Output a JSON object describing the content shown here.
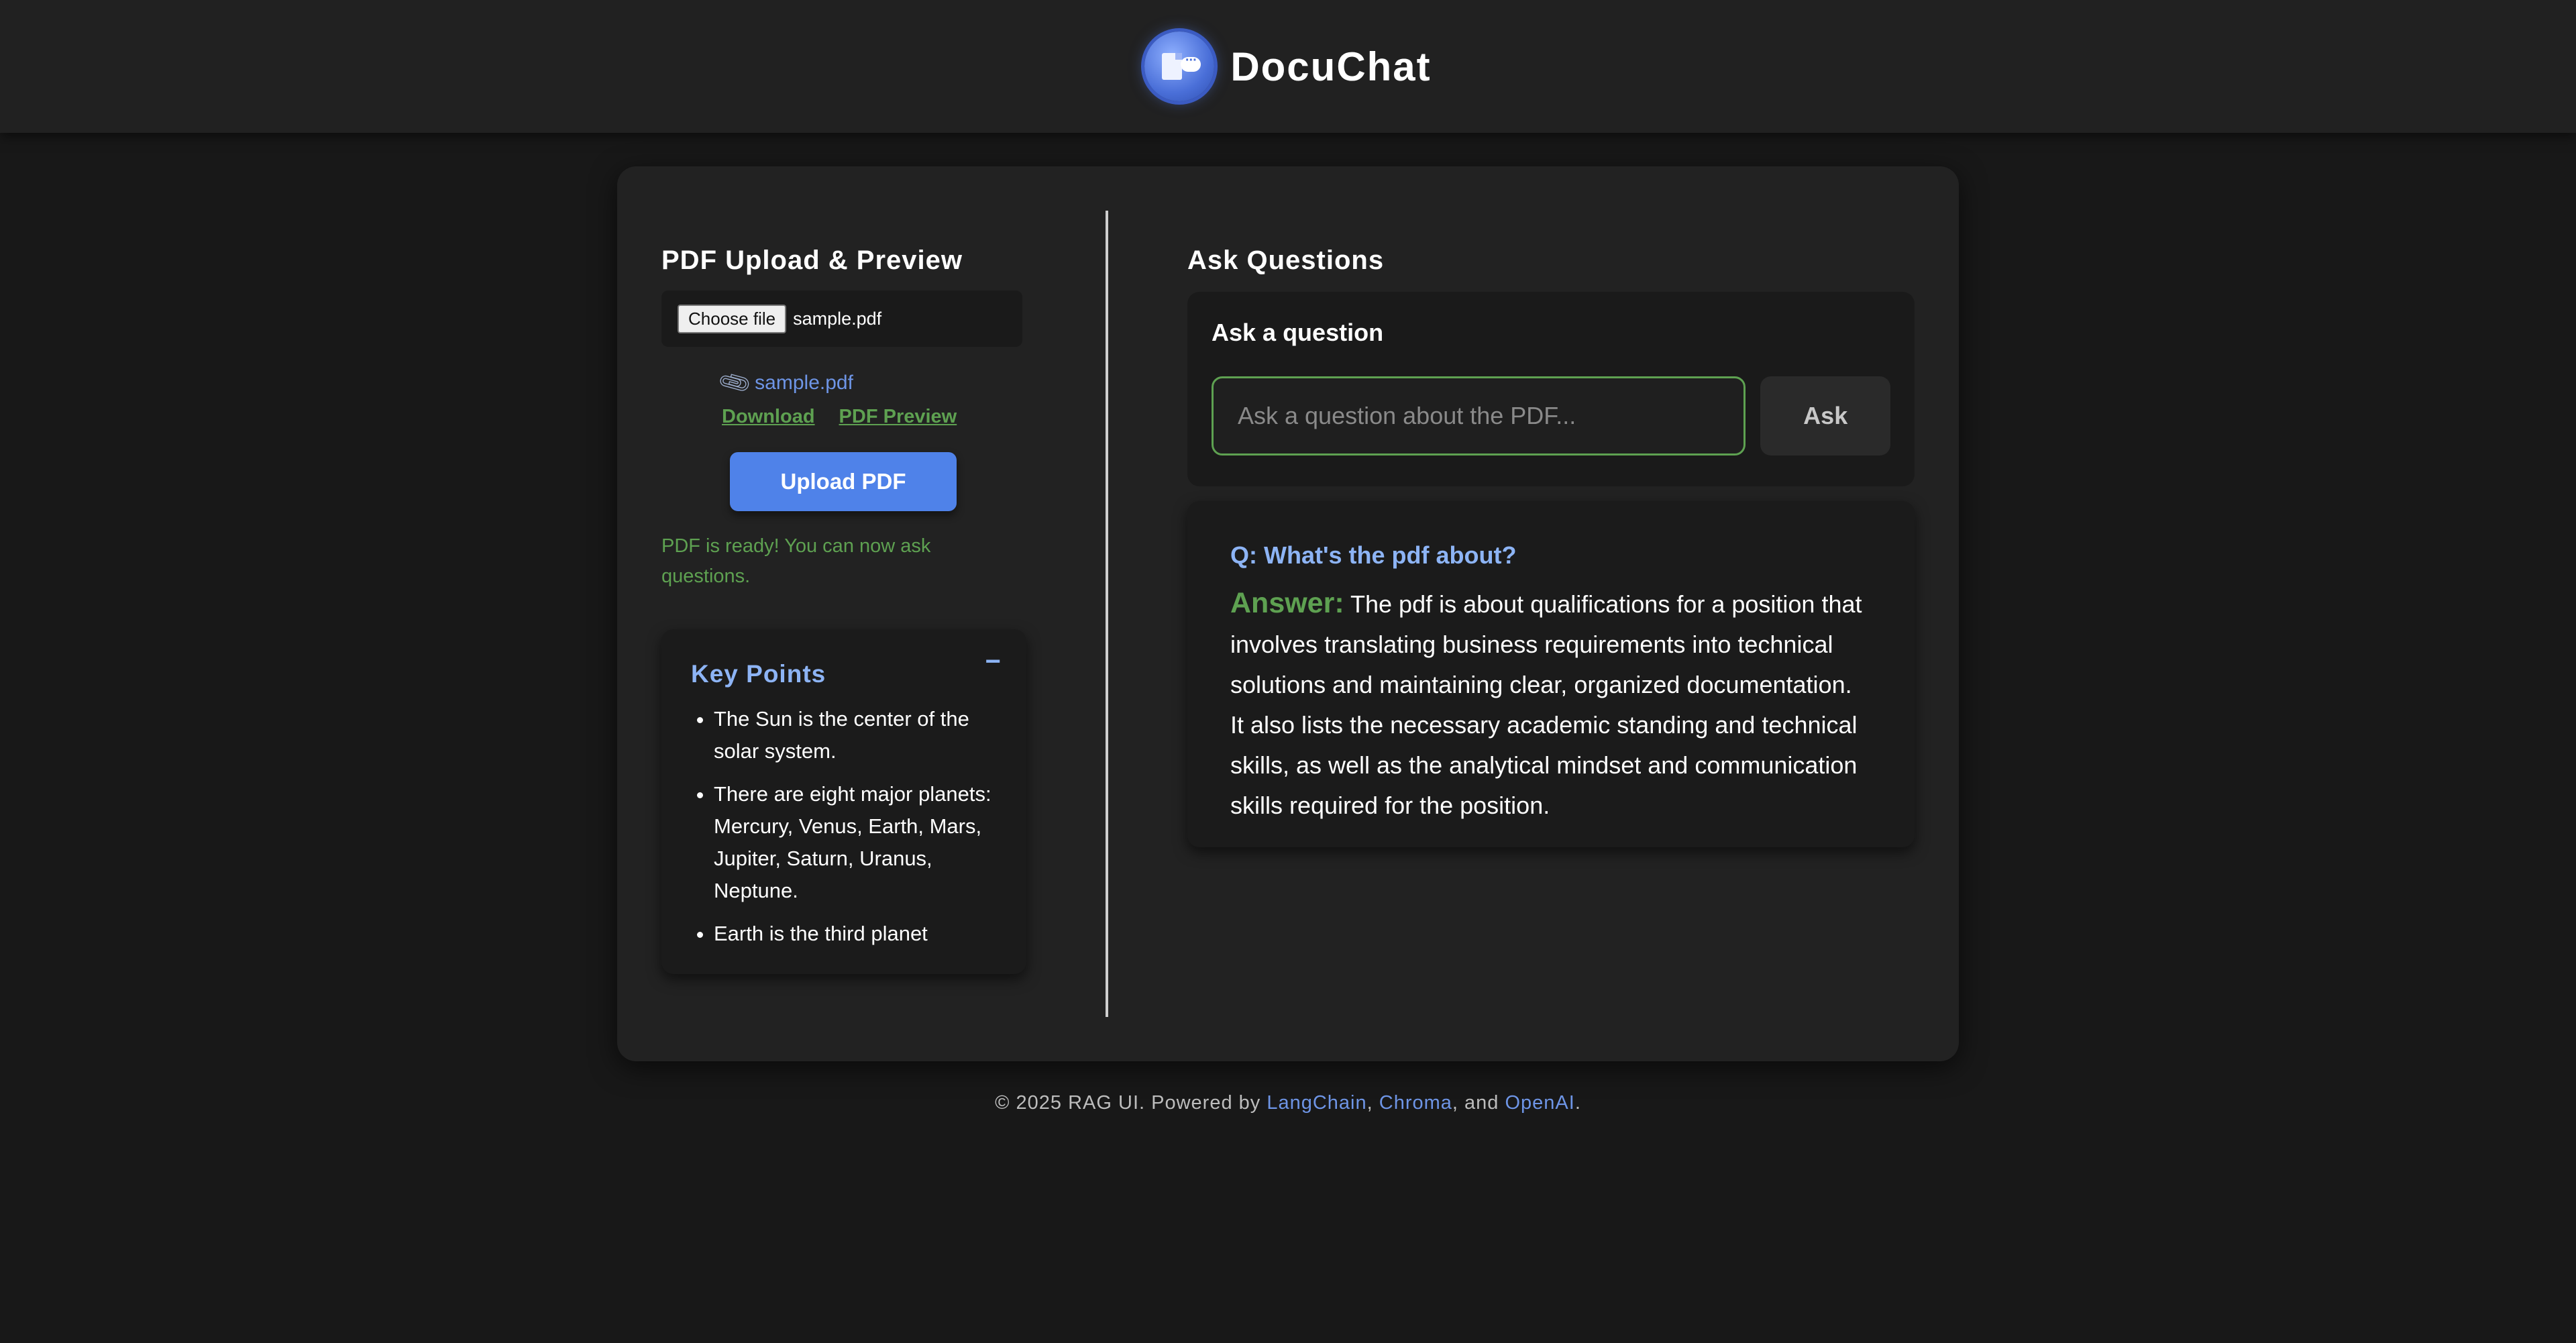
{
  "header": {
    "brand": "DocuChat",
    "logo_icon": "doc-chat-logo"
  },
  "upload_section": {
    "title": "PDF Upload & Preview",
    "file_input": {
      "button_label": "Choose file",
      "selected_file": "sample.pdf"
    },
    "attachment": {
      "icon": "paperclip-icon",
      "file_name": "sample.pdf"
    },
    "links": {
      "download": "Download",
      "preview": "PDF Preview"
    },
    "upload_button": "Upload PDF",
    "status": "PDF is ready! You can now ask questions."
  },
  "key_points": {
    "title": "Key Points",
    "toggle": "−",
    "items": [
      "The Sun is the center of the solar system.",
      "There are eight major planets: Mercury, Venus, Earth, Mars, Jupiter, Saturn, Uranus, Neptune.",
      "Earth is the third planet"
    ]
  },
  "qa_section": {
    "title": "Ask Questions",
    "ask_label": "Ask a question",
    "input_placeholder": "Ask a question about the PDF...",
    "ask_button": "Ask",
    "last_question": "Q: What's the pdf about?",
    "answer_label": "Answer:",
    "answer_text": "The pdf is about qualifications for a position that involves translating business requirements into technical solutions and maintaining clear, organized documentation. It also lists the necessary academic standing and technical skills, as well as the analytical mindset and communication skills required for the position."
  },
  "footer": {
    "prefix": "© 2025 RAG UI. Powered by ",
    "link_langchain": "LangChain",
    "sep1": ", ",
    "link_chroma": "Chroma",
    "sep2": ", and ",
    "link_openai": "OpenAI",
    "suffix": "."
  },
  "colors": {
    "accent_blue": "#4f82e9",
    "link_blue": "#6e95e6",
    "heading_blue": "#8db4f5",
    "success_green": "#5ea151",
    "background": "#181818",
    "card": "#222222"
  }
}
